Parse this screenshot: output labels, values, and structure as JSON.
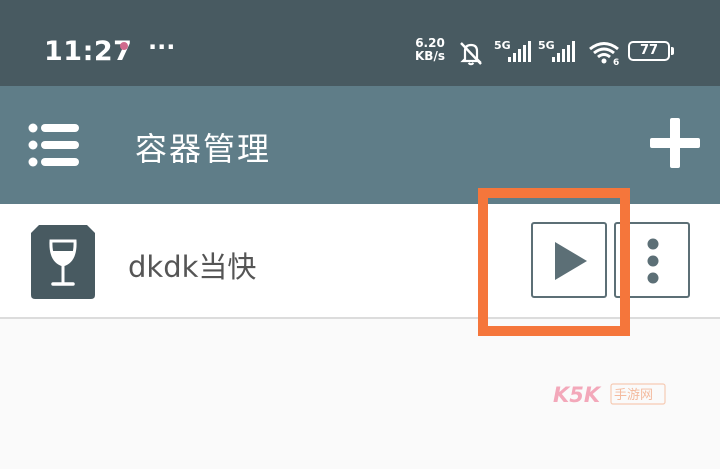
{
  "status_bar": {
    "time": "11:27",
    "more": "···",
    "net_speed_value": "6.20",
    "net_speed_unit": "KB/s",
    "sim1": "5G",
    "sim2": "5G",
    "wifi_badge": "6",
    "battery": "77"
  },
  "app_bar": {
    "title": "容器管理",
    "menu_icon": "hamburger-menu-icon",
    "add_icon": "plus-icon"
  },
  "containers": [
    {
      "name": "dkdk当快",
      "icon": "wine-glass-icon",
      "actions": [
        "play-icon",
        "more-vertical-icon"
      ]
    }
  ],
  "watermark": {
    "brand": "K5K",
    "text": "手游网"
  },
  "colors": {
    "status_bar": "#485a61",
    "app_bar": "#5f7d88",
    "icon_dark": "#485a61",
    "highlight": "#f5763b",
    "background": "#fafafa"
  }
}
